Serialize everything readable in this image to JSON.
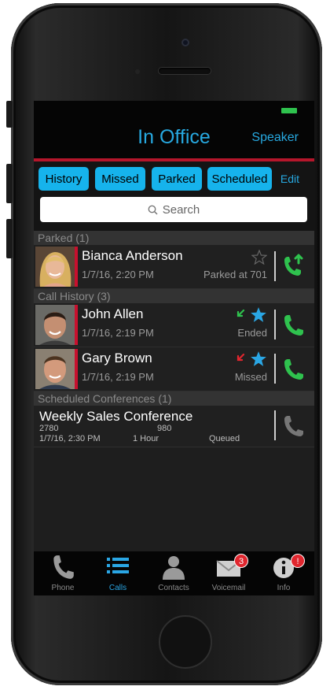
{
  "header": {
    "title": "In Office",
    "speaker_label": "Speaker"
  },
  "tabs": [
    {
      "label": "History"
    },
    {
      "label": "Missed"
    },
    {
      "label": "Parked"
    },
    {
      "label": "Scheduled"
    }
  ],
  "edit_label": "Edit",
  "search": {
    "label": "Search",
    "icon": "search-icon"
  },
  "sections": {
    "parked": "Parked (1)",
    "history": "Call History (3)",
    "scheduled": "Scheduled Conferences (1)"
  },
  "parked": [
    {
      "name": "Bianca Anderson",
      "date": "1/7/16, 2:20 PM",
      "status": "Parked at 701",
      "favorite": false,
      "action_icon": "unpark-call-icon"
    }
  ],
  "history": [
    {
      "name": "John Allen",
      "date": "1/7/16, 2:19 PM",
      "status": "Ended",
      "direction_icon": "incoming-arrow-icon",
      "direction_color": "#2fc24e",
      "favorite": true
    },
    {
      "name": "Gary Brown",
      "date": "1/7/16, 2:19 PM",
      "status": "Missed",
      "direction_icon": "missed-arrow-icon",
      "direction_color": "#e0262e",
      "favorite": true
    }
  ],
  "conferences": [
    {
      "title": "Weekly Sales Conference",
      "number_1": "2780",
      "number_2": "980",
      "date": "1/7/16, 2:30 PM",
      "duration": "1 Hour",
      "status": "Queued"
    }
  ],
  "tabbar": [
    {
      "label": "Phone",
      "icon": "phone-icon",
      "active": false
    },
    {
      "label": "Calls",
      "icon": "list-icon",
      "active": true
    },
    {
      "label": "Contacts",
      "icon": "contact-icon",
      "active": false
    },
    {
      "label": "Voicemail",
      "icon": "voicemail-icon",
      "badge": "3",
      "active": false
    },
    {
      "label": "Info",
      "icon": "info-icon",
      "badge": "!",
      "active": false
    }
  ],
  "colors": {
    "accent": "#27a9e1",
    "tab_bg": "#16b3ec",
    "call_green": "#2fc24e",
    "brand_red": "#b5162b"
  }
}
